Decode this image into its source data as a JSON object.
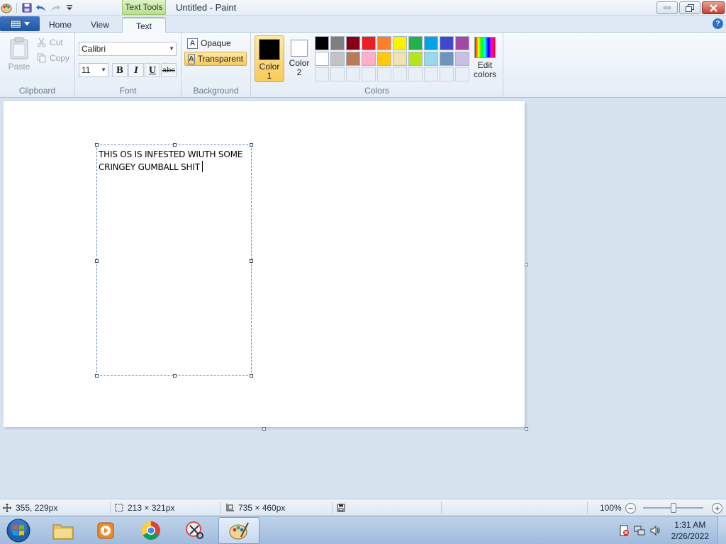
{
  "window": {
    "title": "Untitled - Paint",
    "context_tab": "Text Tools"
  },
  "tabs": {
    "home": "Home",
    "view": "View",
    "text": "Text"
  },
  "clipboard": {
    "paste": "Paste",
    "cut": "Cut",
    "copy": "Copy",
    "group_label": "Clipboard"
  },
  "font": {
    "family": "Calibri",
    "size": "11",
    "bold": "B",
    "italic": "I",
    "underline": "U",
    "strike": "abc",
    "group_label": "Font"
  },
  "background": {
    "opaque": "Opaque",
    "transparent": "Transparent",
    "selected": "Transparent",
    "group_label": "Background"
  },
  "colors": {
    "color1_label": "Color",
    "color1_num": "1",
    "color1_value": "#000000",
    "color2_label": "Color",
    "color2_num": "2",
    "color2_value": "#ffffff",
    "edit_label_1": "Edit",
    "edit_label_2": "colors",
    "group_label": "Colors",
    "palette_row1": [
      "#000000",
      "#7f7f7f",
      "#880015",
      "#ed1c24",
      "#ff7f27",
      "#fff200",
      "#22b14c",
      "#00a2e8",
      "#3f48cc",
      "#a349a4"
    ],
    "palette_row2": [
      "#ffffff",
      "#c3c3c3",
      "#b97a57",
      "#ffaec9",
      "#ffc90e",
      "#efe4b0",
      "#b5e61d",
      "#99d9ea",
      "#7092be",
      "#c8bfe7"
    ]
  },
  "canvas": {
    "text_line1": "THIS OS IS INFESTED WIUTH SOME",
    "text_line2": "CRINGEY GUMBALL SHIT"
  },
  "statusbar": {
    "cursor": "355, 229px",
    "selection": "213 × 321px",
    "image_size": "735 × 460px",
    "zoom": "100%"
  },
  "taskbar": {
    "time": "1:31 AM",
    "date": "2/26/2022"
  }
}
